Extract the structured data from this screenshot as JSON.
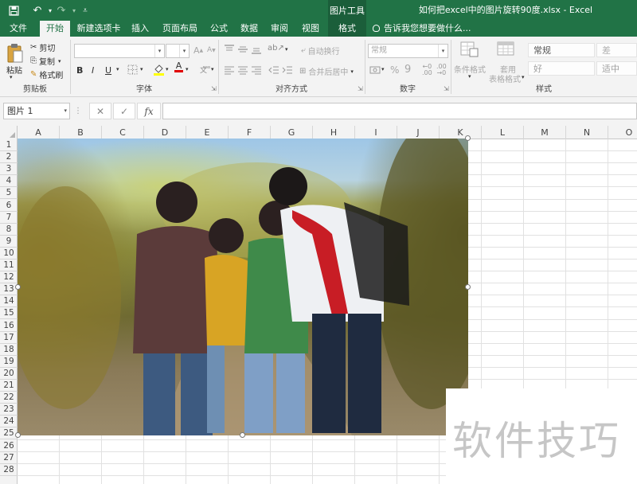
{
  "titlebar": {
    "context_group": "图片工具",
    "doc_title": "如何把excel中的图片旋转90度.xlsx - Excel"
  },
  "tabs": [
    "文件",
    "开始",
    "新建选项卡",
    "插入",
    "页面布局",
    "公式",
    "数据",
    "审阅",
    "视图",
    "格式"
  ],
  "tell_me": "告诉我您想要做什么...",
  "ribbon": {
    "clipboard": {
      "paste": "粘贴",
      "cut": "剪切",
      "copy": "复制",
      "format_painter": "格式刷",
      "label": "剪贴板"
    },
    "font": {
      "bold": "B",
      "italic": "I",
      "underline": "U",
      "label": "字体"
    },
    "alignment": {
      "wrap": "自动换行",
      "merge": "合并后居中",
      "label": "对齐方式"
    },
    "number": {
      "format": "常规",
      "percent": "%",
      "comma": "9",
      "label": "数字"
    },
    "styles": {
      "conditional": "条件格式",
      "table_line1": "套用",
      "table_line2": "表格格式",
      "normal": "常规",
      "bad": "差",
      "good": "好",
      "neutral": "适中",
      "label": "样式"
    }
  },
  "formula_bar": {
    "name_box": "图片 1",
    "fx": "fx"
  },
  "columns": [
    "A",
    "B",
    "C",
    "D",
    "E",
    "F",
    "G",
    "H",
    "I",
    "J",
    "K",
    "L",
    "M",
    "N",
    "O"
  ],
  "rows": [
    "1",
    "2",
    "3",
    "4",
    "5",
    "6",
    "7",
    "8",
    "9",
    "10",
    "11",
    "12",
    "13",
    "14",
    "15",
    "16",
    "17",
    "18",
    "19",
    "20",
    "21",
    "22",
    "23",
    "24",
    "25",
    "26",
    "27",
    "28"
  ],
  "watermark": "软件技巧"
}
